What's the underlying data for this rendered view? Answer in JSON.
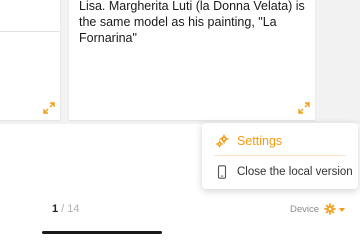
{
  "card": {
    "caption": "Lisa. Margherita Luti (la Donna Velata) is the same model as his painting, \"La Fornarina\""
  },
  "pager": {
    "current": "1",
    "separator": " / ",
    "total": "14"
  },
  "footer": {
    "device_label": "Device"
  },
  "menu": {
    "settings_label": "Settings",
    "close_local_label": "Close the local version"
  },
  "icons": {
    "expand": "expand-arrows-icon",
    "settings": "gear-icon",
    "close_local": "phone-icon",
    "device": "gear-icon",
    "caret": "caret-down-icon"
  },
  "colors": {
    "accent": "#f39c12",
    "text": "#222222",
    "muted": "#b0b0b0"
  }
}
